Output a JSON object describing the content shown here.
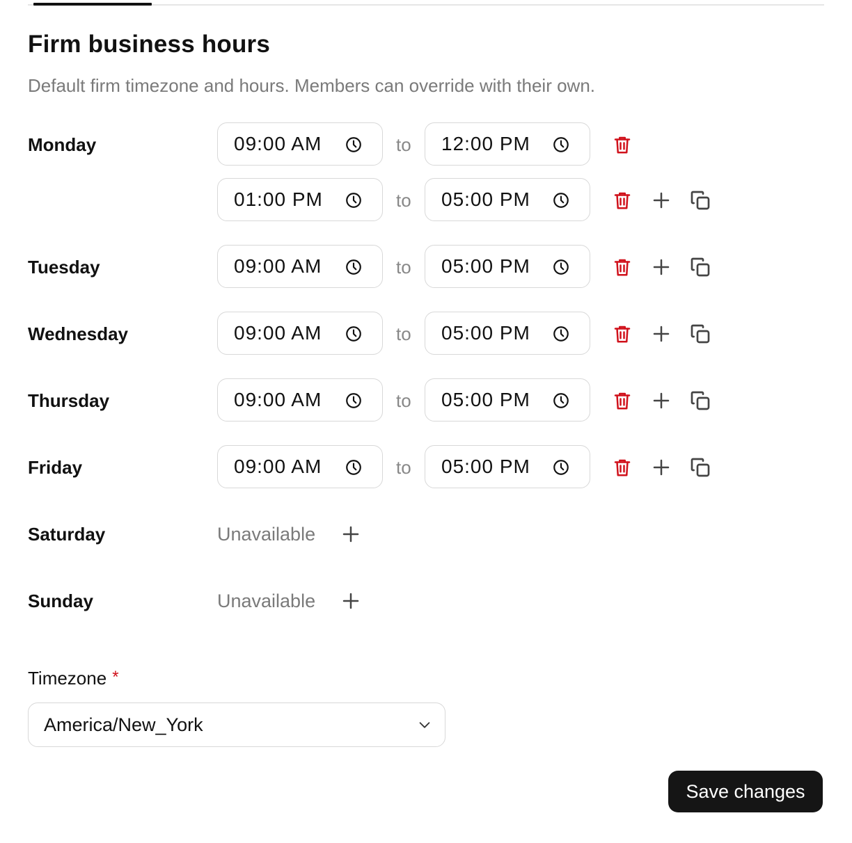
{
  "section": {
    "title": "Firm business hours",
    "description": "Default firm timezone and hours. Members can override with their own."
  },
  "separator": "to",
  "unavailable_label": "Unavailable",
  "colors": {
    "delete": "#d0111b",
    "primary_button": "#151515",
    "muted_text": "#7a7a7a",
    "border": "#d8d8d8"
  },
  "days": [
    {
      "name": "Monday",
      "slots": [
        {
          "start": "09:00 AM",
          "end": "12:00 PM"
        },
        {
          "start": "01:00 PM",
          "end": "05:00 PM"
        }
      ]
    },
    {
      "name": "Tuesday",
      "slots": [
        {
          "start": "09:00 AM",
          "end": "05:00 PM"
        }
      ]
    },
    {
      "name": "Wednesday",
      "slots": [
        {
          "start": "09:00 AM",
          "end": "05:00 PM"
        }
      ]
    },
    {
      "name": "Thursday",
      "slots": [
        {
          "start": "09:00 AM",
          "end": "05:00 PM"
        }
      ]
    },
    {
      "name": "Friday",
      "slots": [
        {
          "start": "09:00 AM",
          "end": "05:00 PM"
        }
      ]
    },
    {
      "name": "Saturday",
      "slots": []
    },
    {
      "name": "Sunday",
      "slots": []
    }
  ],
  "icons": {
    "time": "clock-icon",
    "delete": "trash-icon",
    "add": "plus-icon",
    "copy": "copy-icon",
    "dropdown": "chevron-down-icon"
  },
  "timezone": {
    "label": "Timezone",
    "required_marker": "*",
    "value": "America/New_York"
  },
  "save_label": "Save changes"
}
